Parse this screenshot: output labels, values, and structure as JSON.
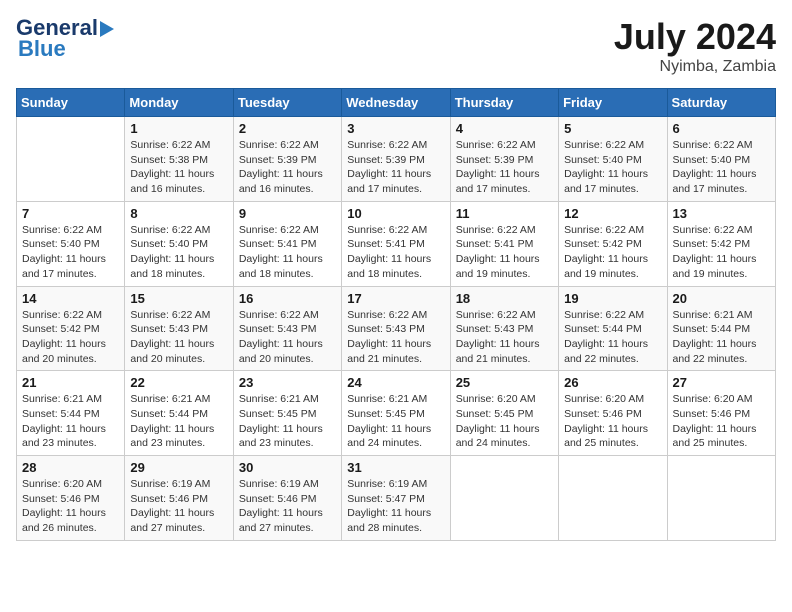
{
  "header": {
    "logo_line1": "General",
    "logo_line2": "Blue",
    "month_year": "July 2024",
    "location": "Nyimba, Zambia"
  },
  "days_of_week": [
    "Sunday",
    "Monday",
    "Tuesday",
    "Wednesday",
    "Thursday",
    "Friday",
    "Saturday"
  ],
  "weeks": [
    [
      {
        "day": "",
        "info": ""
      },
      {
        "day": "1",
        "info": "Sunrise: 6:22 AM\nSunset: 5:38 PM\nDaylight: 11 hours and 16 minutes."
      },
      {
        "day": "2",
        "info": "Sunrise: 6:22 AM\nSunset: 5:39 PM\nDaylight: 11 hours and 16 minutes."
      },
      {
        "day": "3",
        "info": "Sunrise: 6:22 AM\nSunset: 5:39 PM\nDaylight: 11 hours and 17 minutes."
      },
      {
        "day": "4",
        "info": "Sunrise: 6:22 AM\nSunset: 5:39 PM\nDaylight: 11 hours and 17 minutes."
      },
      {
        "day": "5",
        "info": "Sunrise: 6:22 AM\nSunset: 5:40 PM\nDaylight: 11 hours and 17 minutes."
      },
      {
        "day": "6",
        "info": "Sunrise: 6:22 AM\nSunset: 5:40 PM\nDaylight: 11 hours and 17 minutes."
      }
    ],
    [
      {
        "day": "7",
        "info": "Sunrise: 6:22 AM\nSunset: 5:40 PM\nDaylight: 11 hours and 17 minutes."
      },
      {
        "day": "8",
        "info": "Sunrise: 6:22 AM\nSunset: 5:40 PM\nDaylight: 11 hours and 18 minutes."
      },
      {
        "day": "9",
        "info": "Sunrise: 6:22 AM\nSunset: 5:41 PM\nDaylight: 11 hours and 18 minutes."
      },
      {
        "day": "10",
        "info": "Sunrise: 6:22 AM\nSunset: 5:41 PM\nDaylight: 11 hours and 18 minutes."
      },
      {
        "day": "11",
        "info": "Sunrise: 6:22 AM\nSunset: 5:41 PM\nDaylight: 11 hours and 19 minutes."
      },
      {
        "day": "12",
        "info": "Sunrise: 6:22 AM\nSunset: 5:42 PM\nDaylight: 11 hours and 19 minutes."
      },
      {
        "day": "13",
        "info": "Sunrise: 6:22 AM\nSunset: 5:42 PM\nDaylight: 11 hours and 19 minutes."
      }
    ],
    [
      {
        "day": "14",
        "info": "Sunrise: 6:22 AM\nSunset: 5:42 PM\nDaylight: 11 hours and 20 minutes."
      },
      {
        "day": "15",
        "info": "Sunrise: 6:22 AM\nSunset: 5:43 PM\nDaylight: 11 hours and 20 minutes."
      },
      {
        "day": "16",
        "info": "Sunrise: 6:22 AM\nSunset: 5:43 PM\nDaylight: 11 hours and 20 minutes."
      },
      {
        "day": "17",
        "info": "Sunrise: 6:22 AM\nSunset: 5:43 PM\nDaylight: 11 hours and 21 minutes."
      },
      {
        "day": "18",
        "info": "Sunrise: 6:22 AM\nSunset: 5:43 PM\nDaylight: 11 hours and 21 minutes."
      },
      {
        "day": "19",
        "info": "Sunrise: 6:22 AM\nSunset: 5:44 PM\nDaylight: 11 hours and 22 minutes."
      },
      {
        "day": "20",
        "info": "Sunrise: 6:21 AM\nSunset: 5:44 PM\nDaylight: 11 hours and 22 minutes."
      }
    ],
    [
      {
        "day": "21",
        "info": "Sunrise: 6:21 AM\nSunset: 5:44 PM\nDaylight: 11 hours and 23 minutes."
      },
      {
        "day": "22",
        "info": "Sunrise: 6:21 AM\nSunset: 5:44 PM\nDaylight: 11 hours and 23 minutes."
      },
      {
        "day": "23",
        "info": "Sunrise: 6:21 AM\nSunset: 5:45 PM\nDaylight: 11 hours and 23 minutes."
      },
      {
        "day": "24",
        "info": "Sunrise: 6:21 AM\nSunset: 5:45 PM\nDaylight: 11 hours and 24 minutes."
      },
      {
        "day": "25",
        "info": "Sunrise: 6:20 AM\nSunset: 5:45 PM\nDaylight: 11 hours and 24 minutes."
      },
      {
        "day": "26",
        "info": "Sunrise: 6:20 AM\nSunset: 5:46 PM\nDaylight: 11 hours and 25 minutes."
      },
      {
        "day": "27",
        "info": "Sunrise: 6:20 AM\nSunset: 5:46 PM\nDaylight: 11 hours and 25 minutes."
      }
    ],
    [
      {
        "day": "28",
        "info": "Sunrise: 6:20 AM\nSunset: 5:46 PM\nDaylight: 11 hours and 26 minutes."
      },
      {
        "day": "29",
        "info": "Sunrise: 6:19 AM\nSunset: 5:46 PM\nDaylight: 11 hours and 27 minutes."
      },
      {
        "day": "30",
        "info": "Sunrise: 6:19 AM\nSunset: 5:46 PM\nDaylight: 11 hours and 27 minutes."
      },
      {
        "day": "31",
        "info": "Sunrise: 6:19 AM\nSunset: 5:47 PM\nDaylight: 11 hours and 28 minutes."
      },
      {
        "day": "",
        "info": ""
      },
      {
        "day": "",
        "info": ""
      },
      {
        "day": "",
        "info": ""
      }
    ]
  ]
}
